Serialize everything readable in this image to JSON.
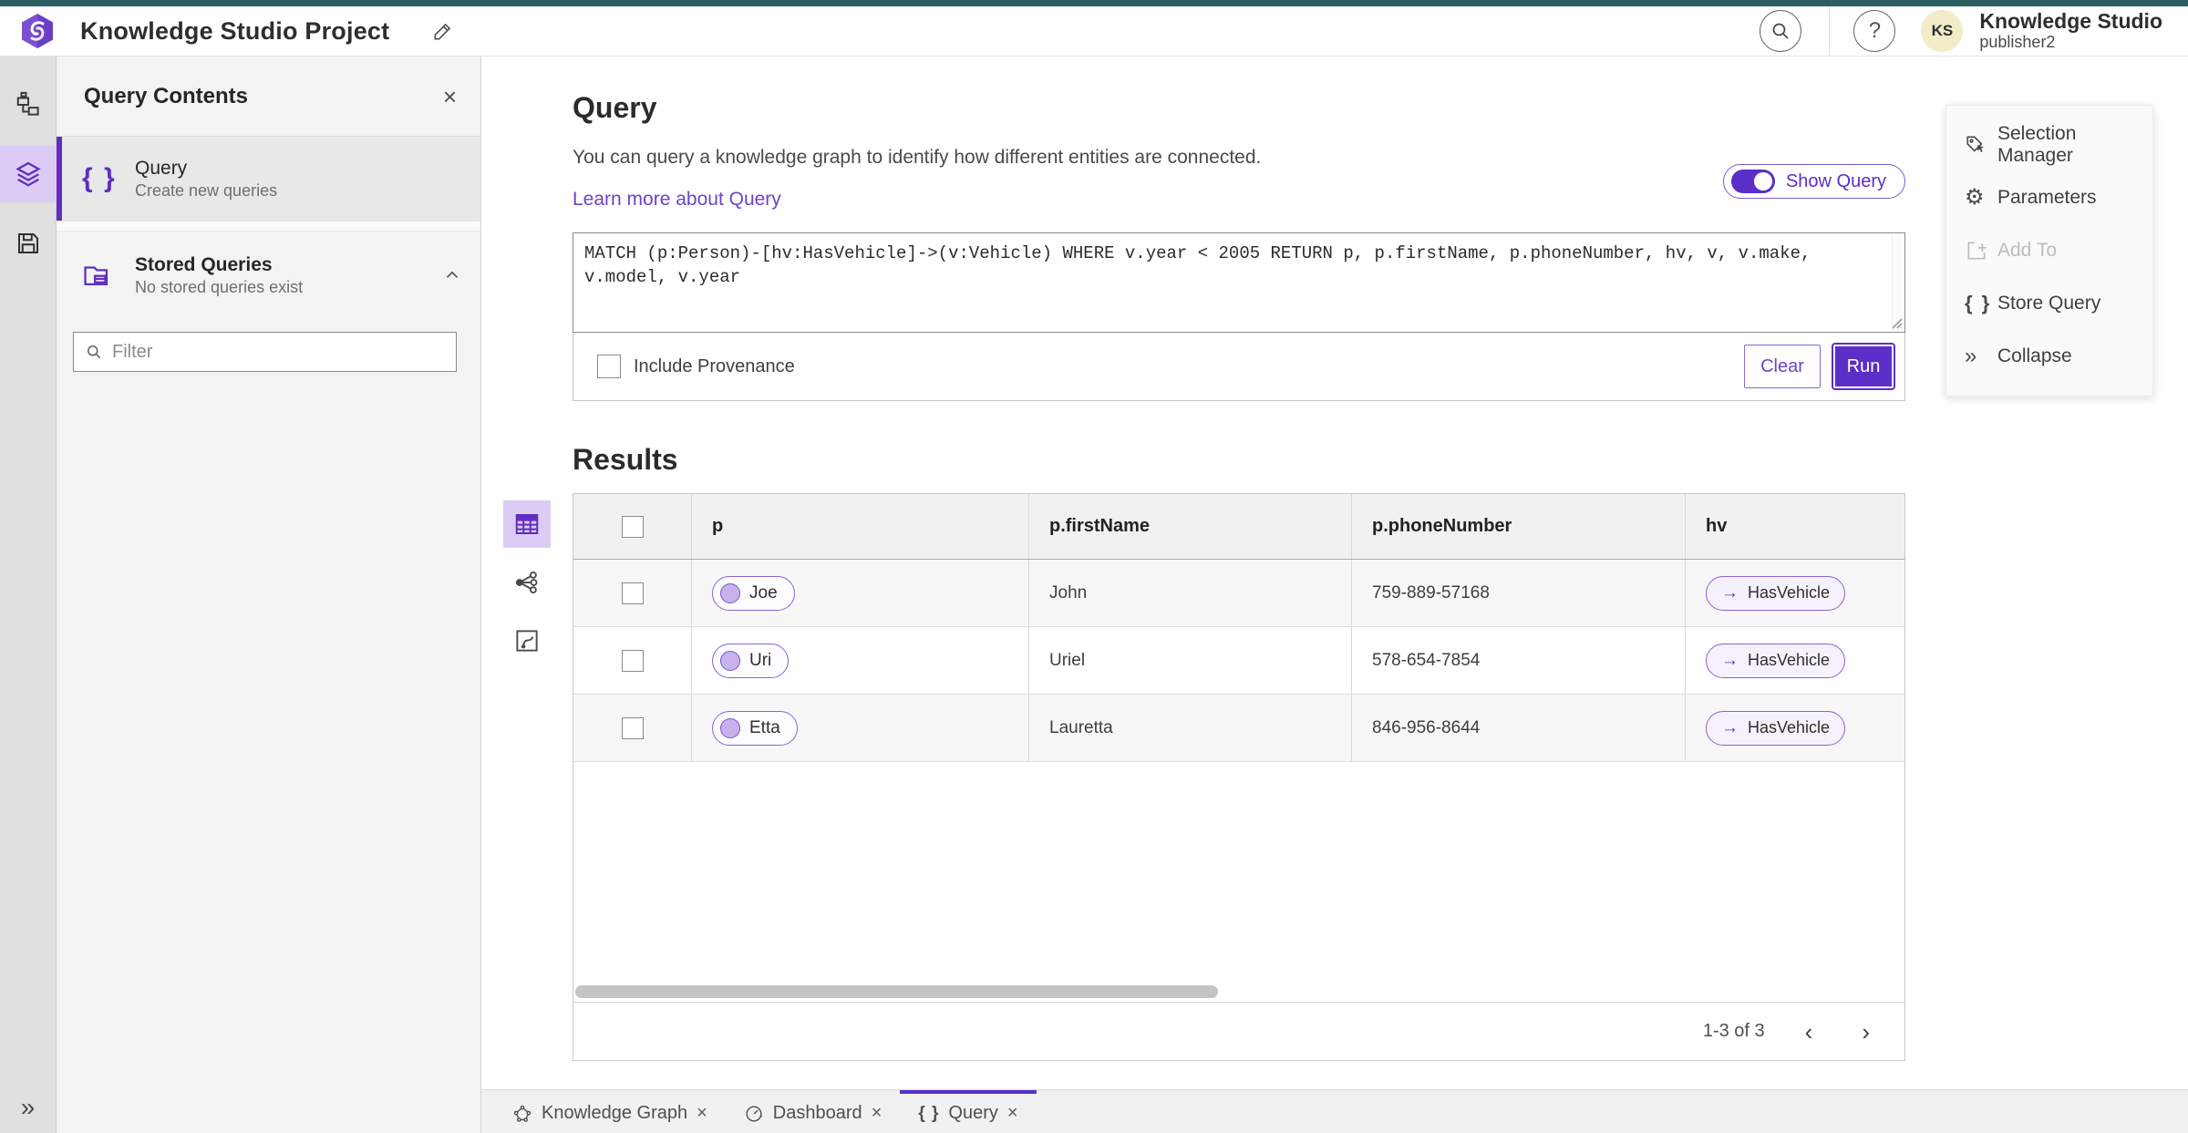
{
  "colors": {
    "accent": "#5B2EC8",
    "accent_soft": "#DCCCF5",
    "teal_top_bar": "#2B5F62",
    "avatar_bg": "#F2ECC8",
    "link": "#6B44C8"
  },
  "header": {
    "title": "Knowledge Studio Project",
    "account_name": "Knowledge Studio",
    "account_user": "publisher2",
    "avatar_initials": "KS"
  },
  "icons": {
    "help": "?",
    "close": "×",
    "braces": "{ }",
    "collapse_chevrons": "»",
    "arrow_right": "→",
    "chevron_left": "‹",
    "chevron_right": "›",
    "gear": "⚙"
  },
  "panel": {
    "title": "Query Contents",
    "query_item": {
      "label": "Query",
      "sublabel": "Create new queries"
    },
    "stored_item": {
      "label": "Stored Queries",
      "sublabel": "No stored queries exist"
    },
    "filter_placeholder": "Filter"
  },
  "query": {
    "heading": "Query",
    "description": "You can query a knowledge graph to identify how different entities are connected.",
    "learn_more": "Learn more about Query",
    "show_query_label": "Show Query",
    "text": "MATCH (p:Person)-[hv:HasVehicle]->(v:Vehicle) WHERE v.year < 2005 RETURN p, p.firstName, p.phoneNumber, hv, v, v.make, v.model, v.year",
    "include_provenance_label": "Include Provenance",
    "clear_label": "Clear",
    "run_label": "Run"
  },
  "results": {
    "heading": "Results",
    "columns": {
      "p": "p",
      "first_name": "p.firstName",
      "phone": "p.phoneNumber",
      "hv": "hv"
    },
    "rows": [
      {
        "p": "Joe",
        "first_name": "John",
        "phone": "759-889-57168",
        "hv": "HasVehicle"
      },
      {
        "p": "Uri",
        "first_name": "Uriel",
        "phone": "578-654-7854",
        "hv": "HasVehicle"
      },
      {
        "p": "Etta",
        "first_name": "Lauretta",
        "phone": "846-956-8644",
        "hv": "HasVehicle"
      }
    ],
    "pagination": "1-3 of 3"
  },
  "tools": {
    "selection_manager": "Selection Manager",
    "parameters": "Parameters",
    "add_to": "Add To",
    "store_query": "Store Query",
    "collapse": "Collapse"
  },
  "tabs": {
    "knowledge_graph": "Knowledge Graph",
    "dashboard": "Dashboard",
    "query": "Query"
  }
}
